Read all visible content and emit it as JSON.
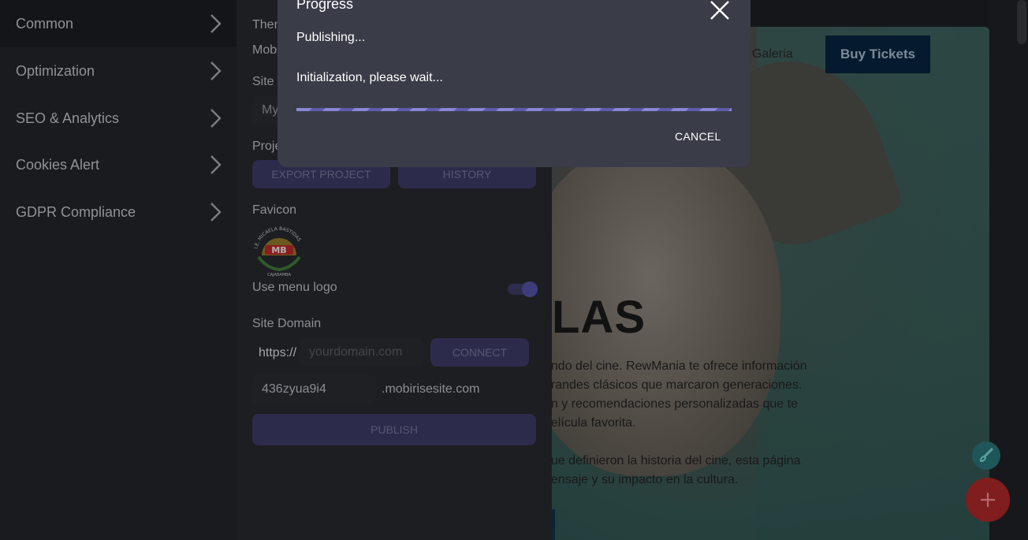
{
  "sidebar": {
    "items": [
      {
        "label": "Common"
      },
      {
        "label": "Optimization"
      },
      {
        "label": "SEO & Analytics"
      },
      {
        "label": "Cookies Alert"
      },
      {
        "label": "GDPR Compliance"
      }
    ]
  },
  "settings": {
    "theme_label_partial": "Them",
    "theme_value_partial": "Mob",
    "site_name_label_partial": "Site I",
    "site_name_value_partial": "My",
    "project_label_partial": "Proje",
    "export_button": "EXPORT PROJECT",
    "history_button": "HISTORY",
    "favicon_label": "Favicon",
    "favicon_logo": {
      "top_text": "I.E. MICAELA BASTIDAS",
      "center_text": "MB",
      "bottom_text": "CAJABAMBA"
    },
    "use_menu_logo_label": "Use menu logo",
    "use_menu_logo_on": true,
    "site_domain_label": "Site Domain",
    "protocol": "https://",
    "domain_placeholder": "yourdomain.com",
    "connect_button": "CONNECT",
    "subdomain_value": "436zyua9i4",
    "subdomain_suffix": ".mobirisesite.com",
    "publish_button": "PUBLISH"
  },
  "preview": {
    "nav_link": "Galeria",
    "buy_tickets": "Buy Tickets",
    "hero_partial": "LAS",
    "paragraph_lines": [
      "undo del cine. RewMania te ofrece información",
      "grandes clásicos que marcaron generaciones.",
      "ón y recomendaciones personalizadas que te",
      "película favorita."
    ],
    "paragraph2_lines": [
      "que definieron la historia del cine, esta página",
      "nensaje y su impacto en la cultura."
    ]
  },
  "dialog": {
    "title": "Progress",
    "status_line": "Publishing...",
    "detail_line": "Initialization, please wait...",
    "cancel_label": "CANCEL"
  },
  "colors": {
    "dialog_bg": "#3a3d48",
    "progress_bar": "#8a87d6",
    "accent_button": "#2c2b4b",
    "fab_add": "#7f1d1f",
    "fab_brush": "#1e5659"
  },
  "icons": [
    "chevron-right-icon",
    "close-icon",
    "brush-icon",
    "plus-icon"
  ]
}
